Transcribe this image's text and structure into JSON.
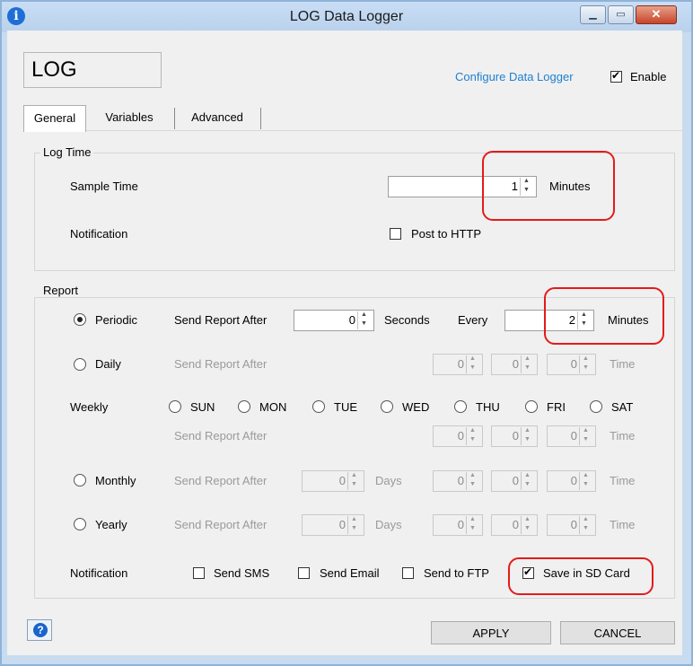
{
  "window": {
    "title": "LOG Data Logger",
    "minimize": "▁",
    "maximize": "▭",
    "close": "✕"
  },
  "header": {
    "name": "LOG",
    "configure_link": "Configure Data Logger",
    "enable_label": "Enable",
    "enable_checked": true
  },
  "tabs": [
    {
      "label": "General",
      "active": true
    },
    {
      "label": "Variables",
      "active": false
    },
    {
      "label": "Advanced",
      "active": false
    }
  ],
  "log_time": {
    "group_label": "Log Time",
    "sample_time_label": "Sample Time",
    "sample_time_value": "1",
    "sample_time_unit": "Minutes",
    "notification_label": "Notification",
    "post_http_label": "Post to HTTP",
    "post_http_checked": false
  },
  "report": {
    "group_label": "Report",
    "send_after": "Send Report After",
    "periodic": {
      "label": "Periodic",
      "selected": true,
      "after_value": "0",
      "seconds": "Seconds",
      "every": "Every",
      "every_value": "2",
      "minutes": "Minutes"
    },
    "daily": {
      "label": "Daily",
      "selected": false,
      "t1": "0",
      "t2": "0",
      "t3": "0",
      "time": "Time"
    },
    "weekly": {
      "label": "Weekly",
      "days": [
        "SUN",
        "MON",
        "TUE",
        "WED",
        "THU",
        "FRI",
        "SAT"
      ],
      "t1": "0",
      "t2": "0",
      "t3": "0",
      "time": "Time"
    },
    "monthly": {
      "label": "Monthly",
      "selected": false,
      "days_value": "0",
      "days": "Days",
      "t1": "0",
      "t2": "0",
      "t3": "0",
      "time": "Time"
    },
    "yearly": {
      "label": "Yearly",
      "selected": false,
      "days_value": "0",
      "days": "Days",
      "t1": "0",
      "t2": "0",
      "t3": "0",
      "time": "Time"
    },
    "notification_label": "Notification",
    "send_sms": "Send SMS",
    "send_email": "Send Email",
    "send_ftp": "Send to FTP",
    "save_sd": "Save in SD Card",
    "save_sd_checked": true
  },
  "footer": {
    "help_icon": "?",
    "apply": "APPLY",
    "cancel": "CANCEL"
  },
  "colors": {
    "highlight": "#e31b1b",
    "link": "#1e7fd1",
    "title_bar": "#c9def5"
  }
}
